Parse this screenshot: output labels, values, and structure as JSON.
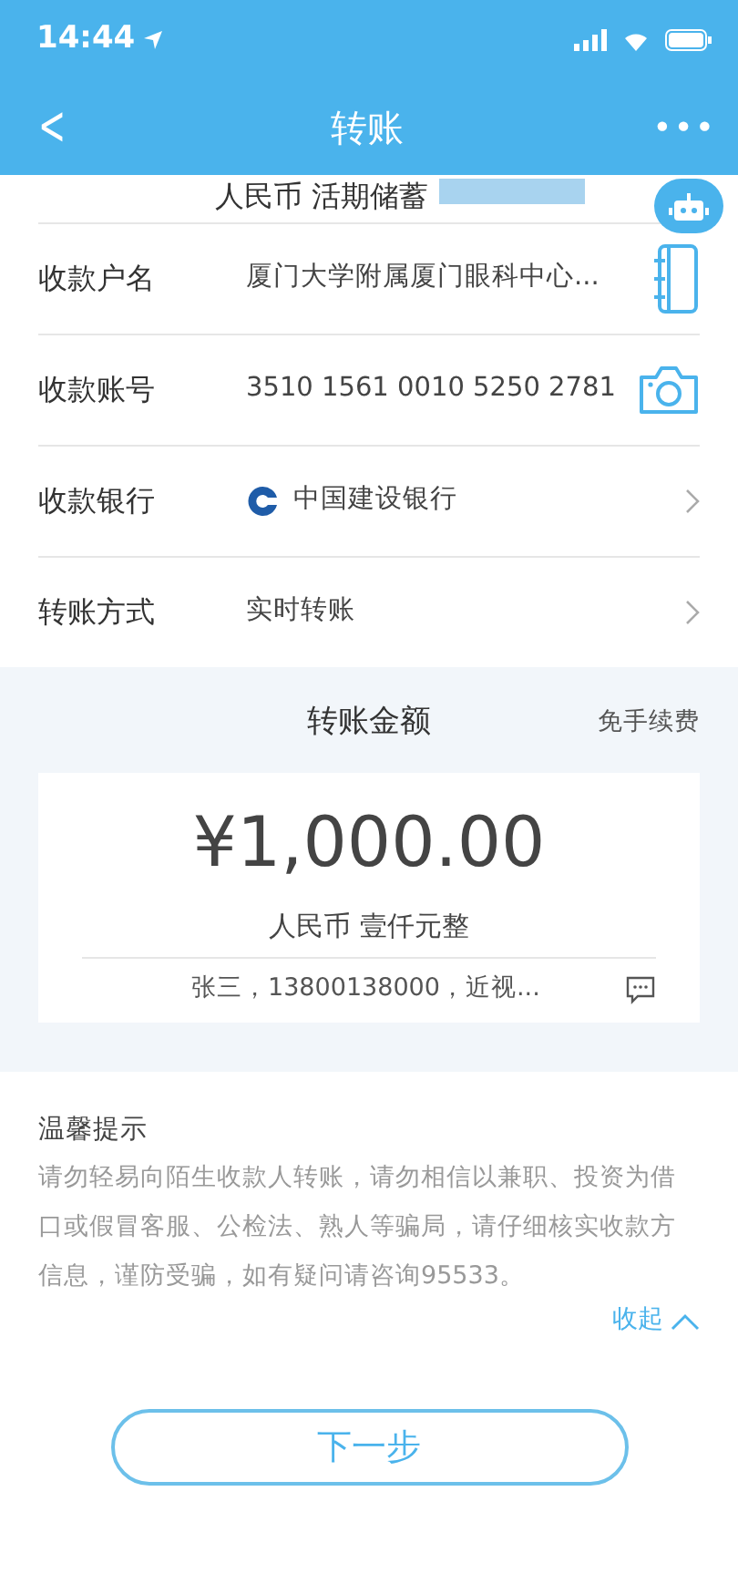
{
  "status_bar": {
    "time": "14:44"
  },
  "nav": {
    "back": "<",
    "title": "转账",
    "more": "•••"
  },
  "account_partial": "人民币 活期储蓄",
  "fields": [
    {
      "kind": "contact",
      "label": "收款户名",
      "value": "厦门大学附属厦门眼科中心..."
    },
    {
      "kind": "camera",
      "label": "收款账号",
      "value": "3510 1561 0010 5250 2781"
    },
    {
      "kind": "bank",
      "label": "收款银行",
      "value": "中国建设银行"
    },
    {
      "kind": "select",
      "label": "转账方式",
      "value": "实时转账"
    }
  ],
  "amount": {
    "title": "转账金额",
    "fee_note": "免手续费",
    "value": "¥1,000.00",
    "in_words": "人民币 壹仟元整",
    "remark": "张三，13800138000，近视..."
  },
  "tips": {
    "title": "温馨提示",
    "body": "请勿轻易向陌生收款人转账，请勿相信以兼职、投资为借口或假冒客服、公检法、熟人等骗局，请仔细核实收款方信息，谨防受骗，如有疑问请咨询95533。",
    "toggle": "收起",
    "expanded": true
  },
  "next_button": "下一步"
}
